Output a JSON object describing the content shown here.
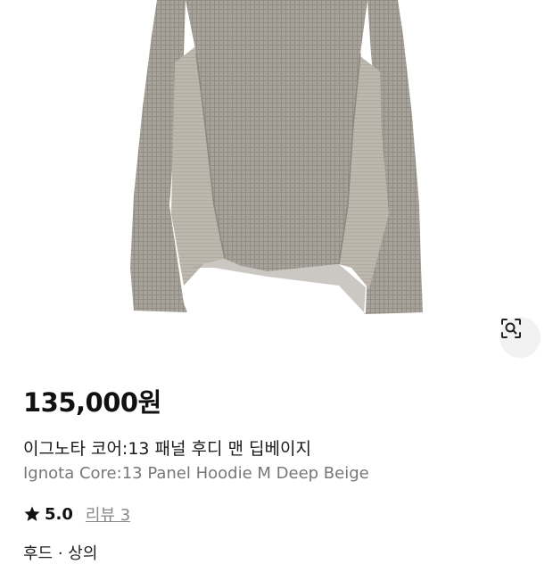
{
  "product": {
    "price": "135,000원",
    "title_ko": "이그노타 코어:13 패널 후디 맨 딥베이지",
    "title_en": "Ignota Core:13 Panel Hoodie M Deep Beige",
    "rating": "5.0",
    "review_link": "리뷰 3",
    "category": "후드 · 상의"
  },
  "icons": {
    "star": "star-icon",
    "lens": "image-search-icon"
  },
  "colors": {
    "garment_main": "#a39e96",
    "garment_panel": "#b9b3aa",
    "star": "#111111",
    "review_link": "#888888"
  }
}
